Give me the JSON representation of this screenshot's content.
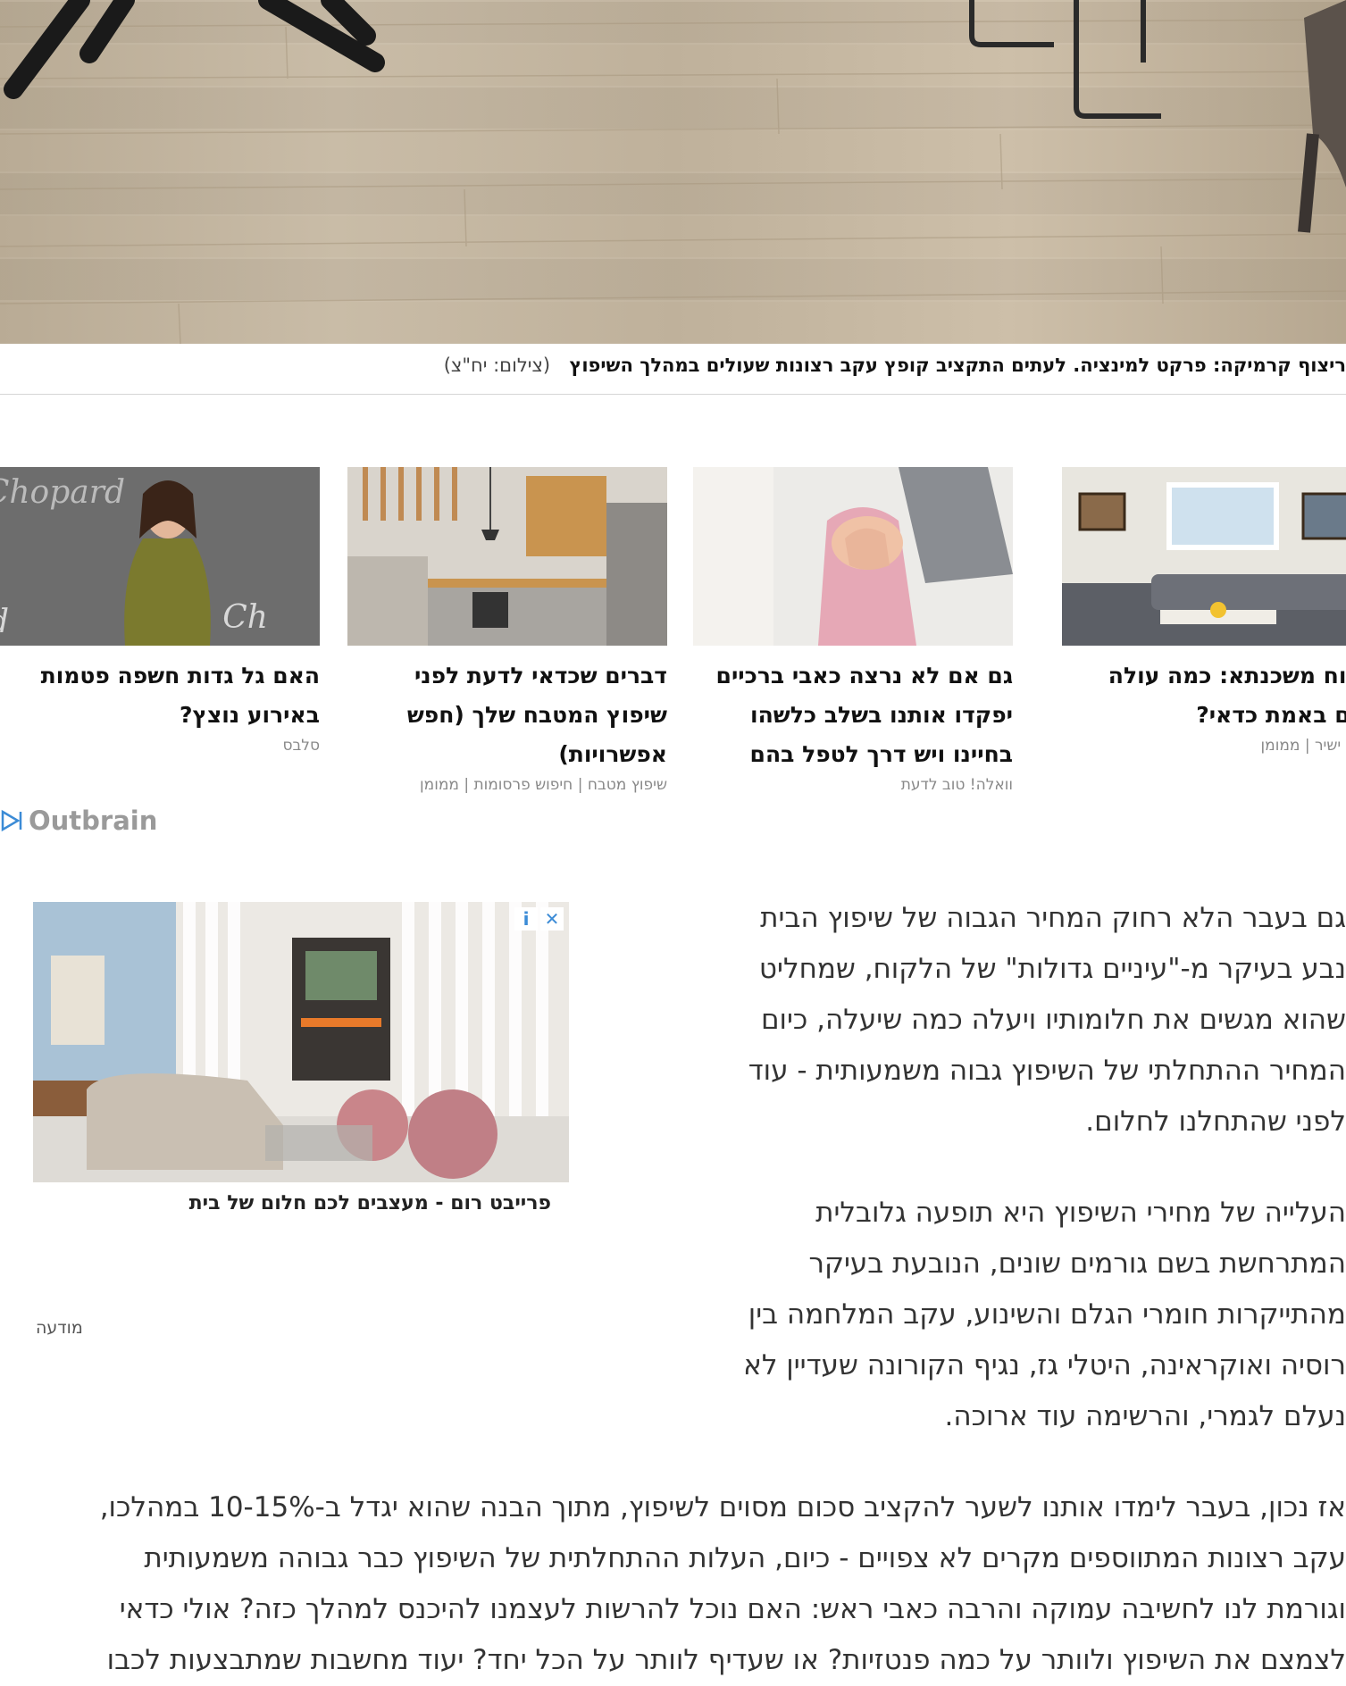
{
  "hero": {
    "image_desc": "wood-look ceramic floor with chair legs"
  },
  "caption": {
    "text": "ריצוף קרמיקה: פרקט למינציה. לעתים התקציב קופץ עקב רצונות שעולים במהלך השיפוץ",
    "credit": "(צילום: יח\"צ)"
  },
  "cards": [
    {
      "title_lines": [
        "ביטוח משכנתא: כמה עולה",
        "האם באמת כדאי?"
      ],
      "source": "ביטוח ישיר | ממומן",
      "image": "living-room"
    },
    {
      "title_lines": [
        "גם אם לא נרצה כאבי ברכיים",
        "יפקדו אותנו בשלב כלשהו",
        "בחיינו ויש דרך לטפל בהם"
      ],
      "source": "וואלה! טוב לדעת",
      "image": "knee-pain"
    },
    {
      "title_lines": [
        "דברים שכדאי לדעת לפני",
        "שיפוץ המטבח שלך (חפש",
        "אפשרויות)"
      ],
      "source": "שיפוץ מטבח | חיפוש פרסומות | ממומן",
      "image": "kitchen"
    },
    {
      "title_lines": [
        "האם גל גדות חשפה פטמות",
        "באירוע נוצץ?"
      ],
      "source": "סלבס",
      "image": "celebrity"
    }
  ],
  "outbrain": {
    "label": "Outbrain"
  },
  "ad": {
    "title": "פרייבט רום - מעצבים לכם חלום של בית",
    "label": "מודעה",
    "info_icon": "i",
    "close_icon": "✕"
  },
  "article": {
    "p1": "גם בעבר הלא רחוק המחיר הגבוה של שיפוץ הבית\nנבע בעיקר מ-\"עיניים גדולות\" של הלקוח, שמחליט\nשהוא מגשים את חלומותיו ויעלה כמה שיעלה, כיום\nהמחיר ההתחלתי של השיפוץ גבוה משמעותית - עוד\nלפני שהתחלנו לחלום.",
    "p2": "העלייה של מחירי השיפוץ היא תופעה גלובלית\nהמתרחשת בשם גורמים שונים, הנובעת בעיקר\nמהתייקרות חומרי הגלם והשינוע, עקב המלחמה בין\nרוסיה ואוקראינה, היטלי גז, נגיף הקורונה שעדיין לא\nנעלם לגמרי, והרשימה עוד ארוכה.",
    "p3": "אז נכון, בעבר לימדו אותנו לשער להקציב סכום מסוים לשיפוץ, מתוך הבנה שהוא יגדל ב-10-15% במהלכו,\nעקב רצונות המתווספים מקרים לא צפויים - כיום, העלות ההתחלתית של השיפוץ כבר גבוהה משמעותית\nוגורמת לנו לחשיבה עמוקה והרבה כאבי ראש: האם נוכל להרשות לעצמנו להיכנס למהלך כזה? אולי כדאי\nלצמצם את השיפוץ ולוותר על כמה פנטזיות? או שעדיף לוותר על הכל יחד? יעוד מחשבות שמתבצעות לכבו"
  }
}
